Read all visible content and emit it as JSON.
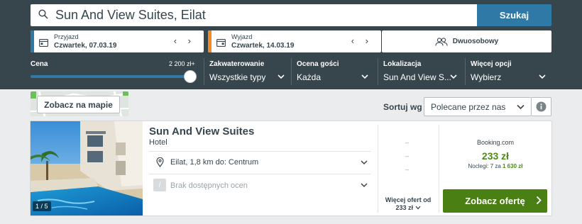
{
  "search": {
    "query": "Sun And View Suites, Eilat",
    "button_label": "Szukaj"
  },
  "checkin": {
    "label": "Przyjazd",
    "value": "Czwartek, 07.03.19",
    "accent": "#2f79a6"
  },
  "checkout": {
    "label": "Wyjazd",
    "value": "Czwartek, 14.03.19",
    "accent": "#f08a24"
  },
  "room": {
    "label": "Dwuosobowy"
  },
  "filters": {
    "price": {
      "label": "Cena",
      "max_value": "2 200 zł+",
      "slider_fraction": 1.0
    },
    "board": {
      "label": "Zakwaterowanie",
      "value": "Wszystkie typy"
    },
    "rating": {
      "label": "Ocena gości",
      "value": "Każda"
    },
    "location": {
      "label": "Lokalizacja",
      "value": "Sun And View S..."
    },
    "more": {
      "label": "Więcej opcji",
      "value": "Wybierz"
    }
  },
  "map": {
    "button_label": "Zobacz na mapie"
  },
  "sort": {
    "label": "Sortuj wg",
    "value": "Polecane przez nas"
  },
  "hotel": {
    "name": "Sun And View Suites",
    "type": "Hotel",
    "location": "Eilat, 1,8 km do: Centrum",
    "rating_glyph": "/",
    "rating_text": "Brak dostępnych ocen",
    "photo_counter": "1 / 5",
    "other_offers": [
      "–",
      "–",
      "–"
    ],
    "more_offers_line1": "Więcej ofert od",
    "more_offers_line2": "233 zł",
    "deal_site": "Booking.com",
    "deal_price": "233 zł",
    "nights_prefix": "Noclegi: 7 za",
    "nights_total": "1 630 zł",
    "cta_label": "Zobacz ofertę"
  },
  "colors": {
    "header_bg": "#37454d",
    "primary_blue": "#2f79a6",
    "price_green": "#4c8a1a",
    "cta_green": "#4a7f14"
  }
}
